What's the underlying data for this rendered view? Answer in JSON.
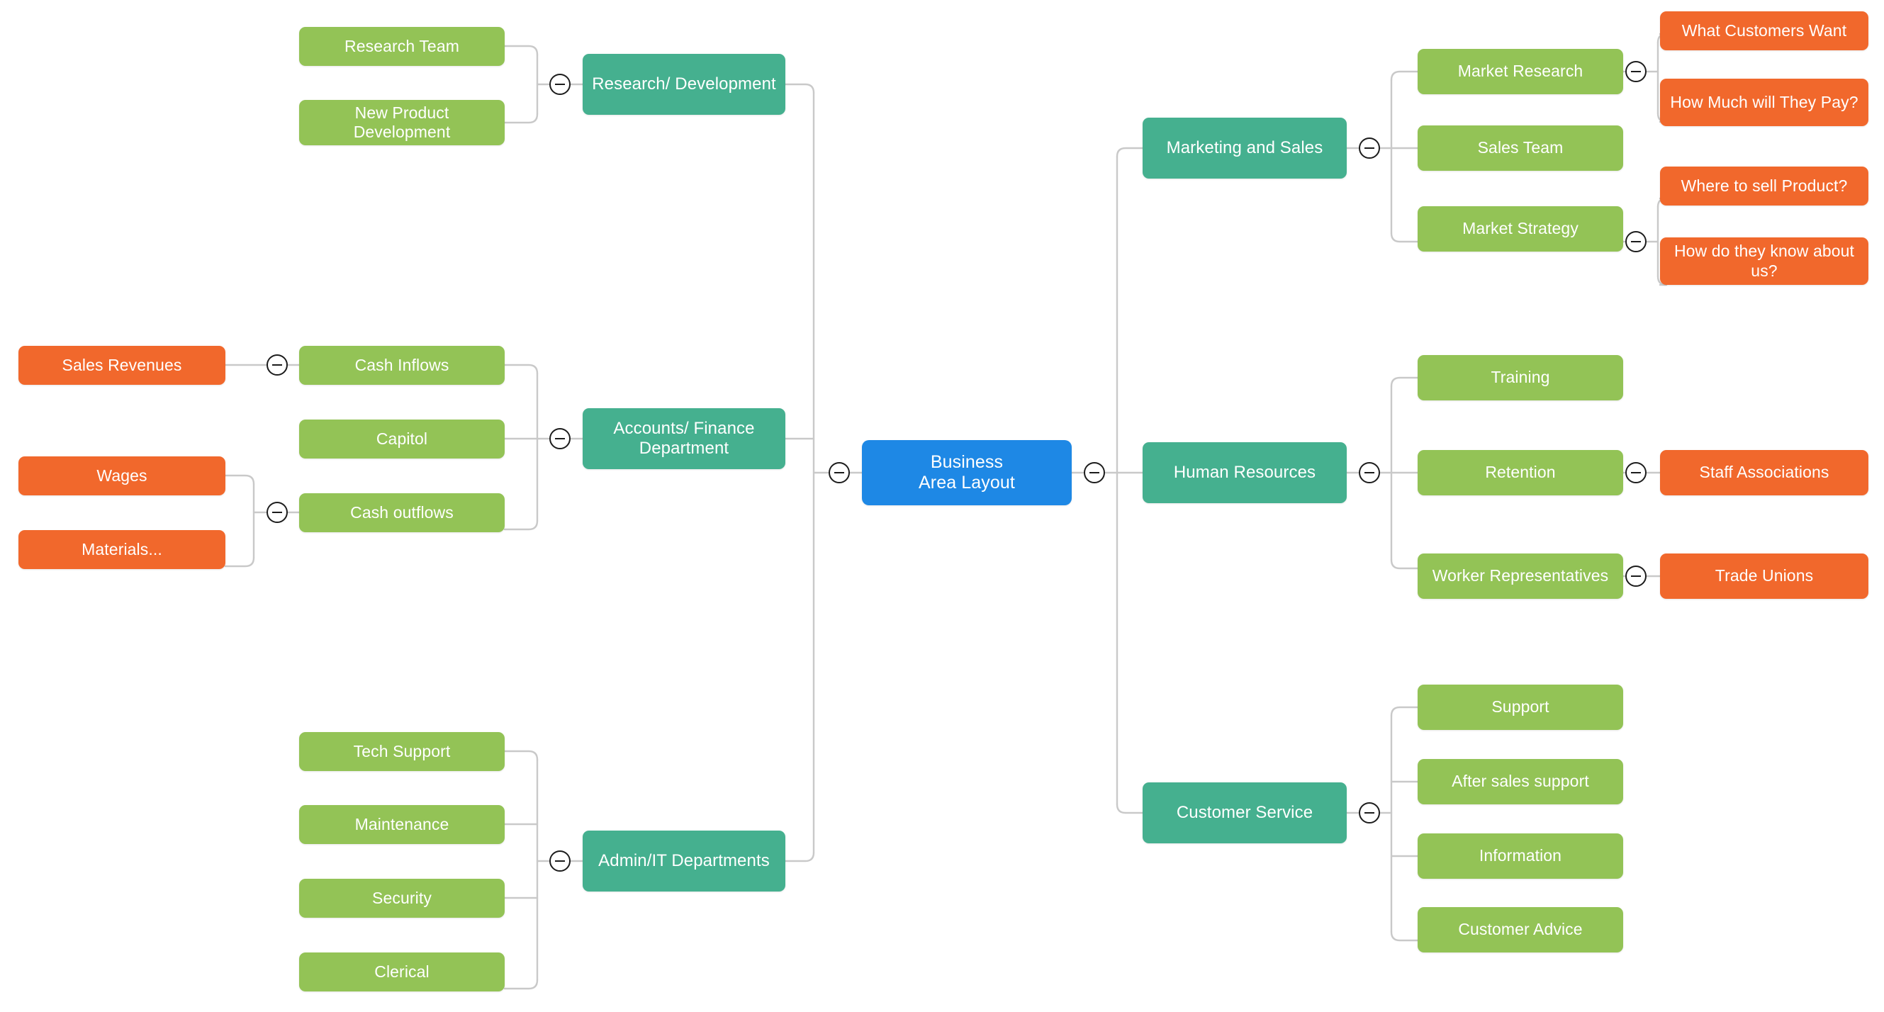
{
  "diagram": {
    "title": "Business Area Layout",
    "type": "mind-map",
    "background": "#ffffff",
    "connector_color": "#c9c9c9",
    "colors": {
      "root": "#1e88e5",
      "branch": "#45b08f",
      "sub": "#93c356",
      "leaf": "#f1682c",
      "toggle_border": "#1c1c1c",
      "text": "#ffffff"
    },
    "toggle_icon": "minus-circle-collapse-icon"
  },
  "root": {
    "label": "Business\nArea Layout",
    "line1": "Business",
    "line2": "Area Layout"
  },
  "left_branches": [
    {
      "id": "research-development",
      "label": "Research/ Development",
      "children": [
        {
          "id": "research-team",
          "label": "Research Team",
          "children": []
        },
        {
          "id": "new-product-development",
          "label": "New Product Development",
          "children": []
        }
      ]
    },
    {
      "id": "accounts-finance-department",
      "label": "Accounts/ Finance Department",
      "children": [
        {
          "id": "cash-inflows",
          "label": "Cash Inflows",
          "children": [
            {
              "id": "sales-revenues",
              "label": "Sales Revenues"
            }
          ]
        },
        {
          "id": "capitol",
          "label": "Capitol",
          "children": []
        },
        {
          "id": "cash-outflows",
          "label": "Cash outflows",
          "children": [
            {
              "id": "wages",
              "label": "Wages"
            },
            {
              "id": "materials",
              "label": "Materials..."
            }
          ]
        }
      ]
    },
    {
      "id": "admin-it-departments",
      "label": "Admin/IT Departments",
      "children": [
        {
          "id": "tech-support",
          "label": "Tech Support",
          "children": []
        },
        {
          "id": "maintenance",
          "label": "Maintenance",
          "children": []
        },
        {
          "id": "security",
          "label": "Security",
          "children": []
        },
        {
          "id": "clerical",
          "label": "Clerical",
          "children": []
        }
      ]
    }
  ],
  "right_branches": [
    {
      "id": "marketing-and-sales",
      "label": "Marketing and Sales",
      "children": [
        {
          "id": "market-research",
          "label": "Market Research",
          "children": [
            {
              "id": "what-customers-want",
              "label": "What Customers Want"
            },
            {
              "id": "how-much-will-they-pay",
              "label": "How Much will They Pay?"
            }
          ]
        },
        {
          "id": "sales-team",
          "label": "Sales Team",
          "children": []
        },
        {
          "id": "market-strategy",
          "label": "Market Strategy",
          "children": [
            {
              "id": "where-to-sell-product",
              "label": "Where to sell Product?"
            },
            {
              "id": "how-do-they-know-about-us",
              "label": "How do they know about us?"
            }
          ]
        }
      ]
    },
    {
      "id": "human-resources",
      "label": "Human Resources",
      "children": [
        {
          "id": "training",
          "label": "Training",
          "children": []
        },
        {
          "id": "retention",
          "label": "Retention",
          "children": [
            {
              "id": "staff-associations",
              "label": "Staff Associations"
            }
          ]
        },
        {
          "id": "worker-representatives",
          "label": "Worker Representatives",
          "children": [
            {
              "id": "trade-unions",
              "label": "Trade Unions"
            }
          ]
        }
      ]
    },
    {
      "id": "customer-service",
      "label": "Customer Service",
      "children": [
        {
          "id": "support",
          "label": "Support",
          "children": []
        },
        {
          "id": "after-sales-support",
          "label": "After sales support",
          "children": []
        },
        {
          "id": "information",
          "label": "Information",
          "children": []
        },
        {
          "id": "customer-advice",
          "label": "Customer Advice",
          "children": []
        }
      ]
    }
  ]
}
